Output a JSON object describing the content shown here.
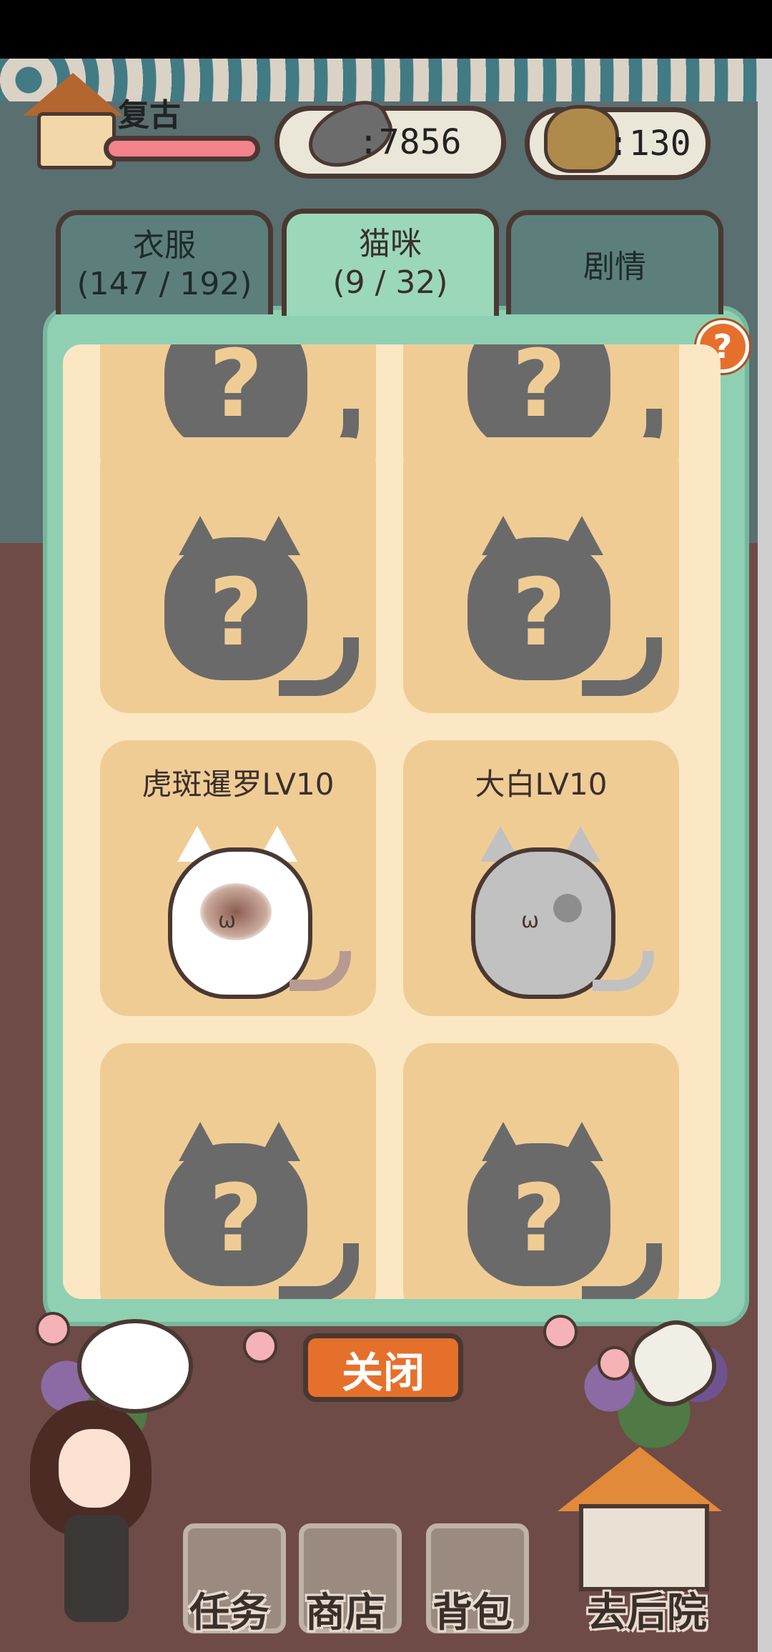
{
  "hud": {
    "player_name": "复古",
    "fish_count": "7856",
    "poop_count": "130"
  },
  "tabs": [
    {
      "title": "衣服",
      "count": "(147 / 192)",
      "active": false
    },
    {
      "title": "猫咪",
      "count": "(9 / 32)",
      "active": true
    },
    {
      "title": "剧情",
      "count": "",
      "active": false
    }
  ],
  "help_label": "?",
  "cards": [
    {
      "label": "",
      "known": false
    },
    {
      "label": "",
      "known": false
    },
    {
      "label": "",
      "known": false
    },
    {
      "label": "",
      "known": false
    },
    {
      "label": "虎斑暹罗LV10",
      "known": true,
      "breed": "siamese"
    },
    {
      "label": "大白LV10",
      "known": true,
      "breed": "grey"
    },
    {
      "label": "",
      "known": false
    },
    {
      "label": "",
      "known": false
    }
  ],
  "unknown_mark": "?",
  "close_label": "关闭",
  "bottom_nav": {
    "tasks": "任务",
    "shop": "商店",
    "bag": "背包",
    "backyard": "去后院"
  },
  "colors": {
    "panel_green": "#8fd0b3",
    "card_tan": "#f0cc95",
    "accent_orange": "#e5702c",
    "outline": "#4a3832"
  }
}
